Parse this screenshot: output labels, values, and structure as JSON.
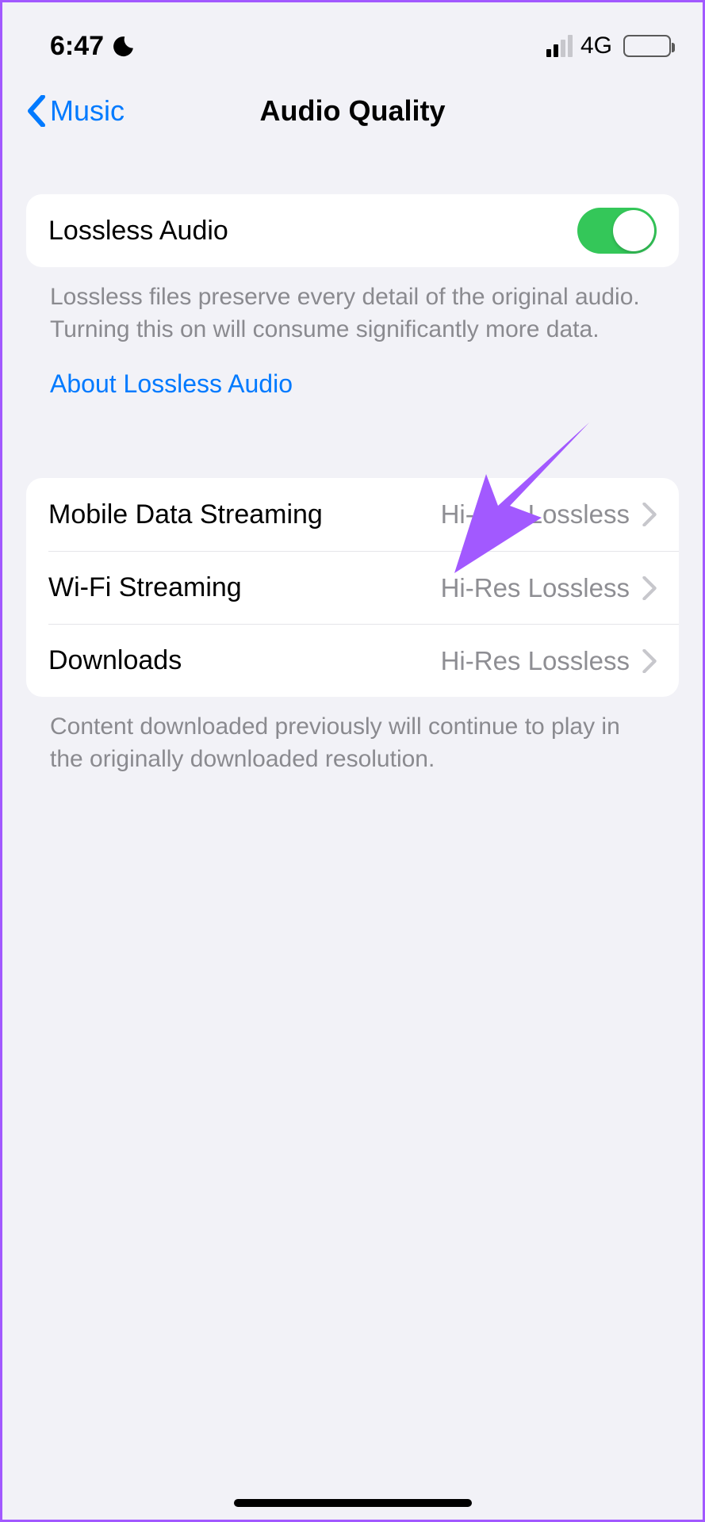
{
  "status": {
    "time": "6:47",
    "network_label": "4G"
  },
  "nav": {
    "back_label": "Music",
    "title": "Audio Quality"
  },
  "lossless": {
    "label": "Lossless Audio",
    "toggle_on": true,
    "note": "Lossless files preserve every detail of the original audio. Turning this on will consume significantly more data.",
    "learn_more": "About Lossless Audio"
  },
  "quality": {
    "rows": [
      {
        "label": "Mobile Data Streaming",
        "value": "Hi-Res Lossless"
      },
      {
        "label": "Wi-Fi Streaming",
        "value": "Hi-Res Lossless"
      },
      {
        "label": "Downloads",
        "value": "Hi-Res Lossless"
      }
    ],
    "note": "Content downloaded previously will continue to play in the originally downloaded resolution."
  },
  "colors": {
    "accent_blue": "#007aff",
    "toggle_green": "#34c759",
    "annotation_purple": "#a259ff"
  }
}
